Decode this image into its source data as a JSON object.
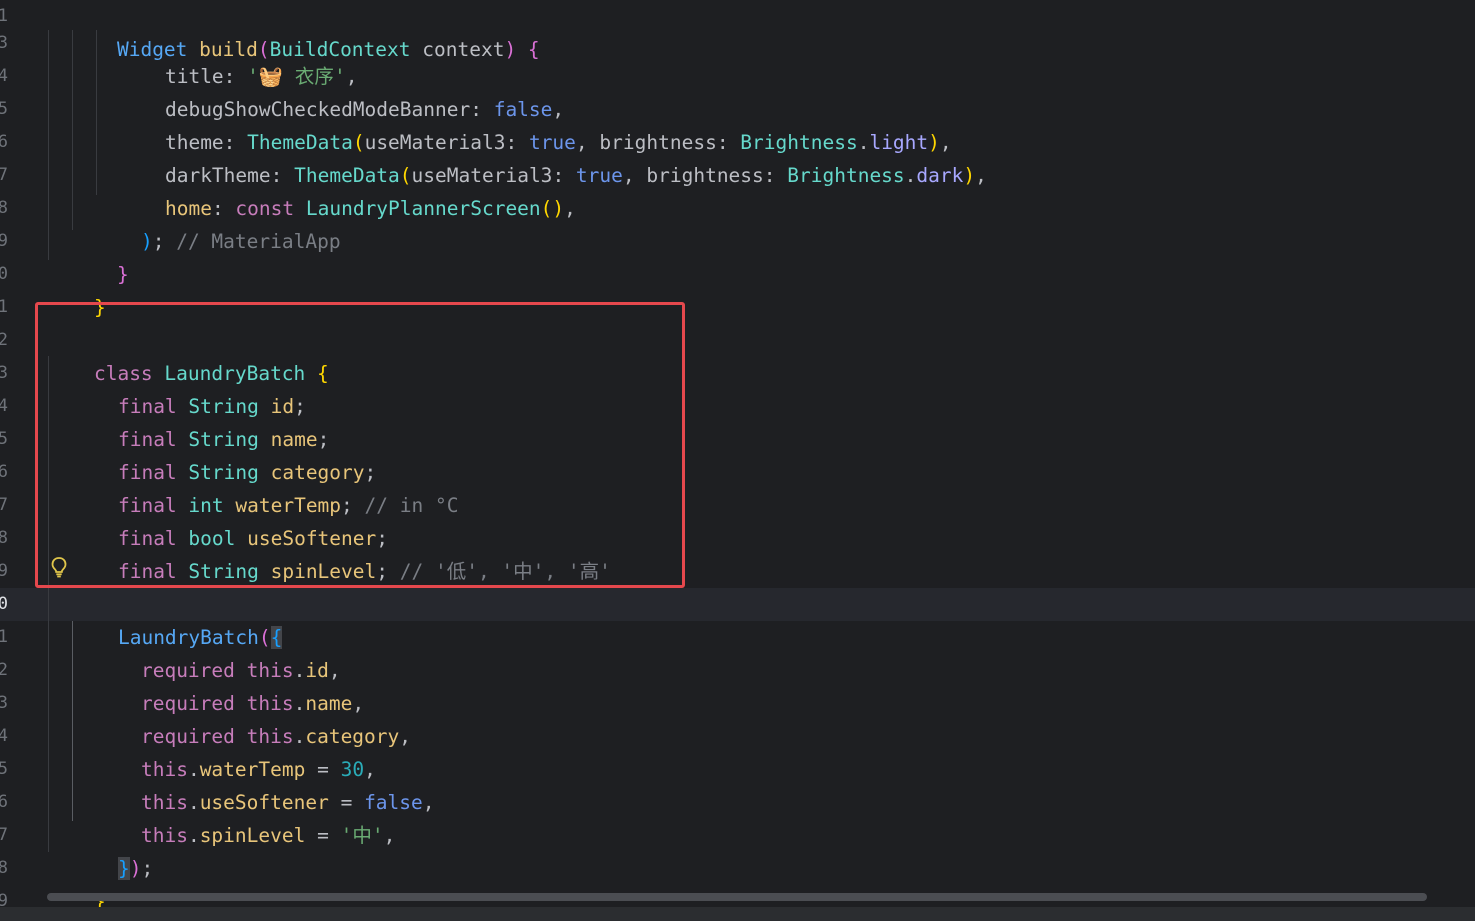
{
  "editor": {
    "gutter_line_numbers": [
      "1",
      "3",
      "4",
      "5",
      "6",
      "7",
      "8",
      "9",
      "0",
      "1",
      "2",
      "3",
      "4",
      "5",
      "6",
      "7",
      "8",
      "9",
      "0",
      "1",
      "2",
      "3",
      "4",
      "5",
      "6",
      "7",
      "8",
      "9"
    ],
    "lines": {
      "l01": {
        "a": "Widget",
        "b": " build",
        "c": "(",
        "d": "BuildContext",
        "e": " context",
        "f": ")",
        "g": " {"
      },
      "l02": {
        "a": "title",
        "b": ": ",
        "c": "'",
        "d": "🧺 衣序",
        "e": "'",
        "f": ","
      },
      "l03": {
        "a": "debugShowCheckedModeBanner",
        "b": ": ",
        "c": "false",
        "d": ","
      },
      "l04": {
        "a": "theme",
        "b": ": ",
        "c": "ThemeData",
        "d": "(",
        "e": "useMaterial3",
        "f": ": ",
        "g": "true",
        "h": ", ",
        "i": "brightness",
        "j": ": ",
        "k": "Brightness",
        "l": ".",
        "m": "light",
        "n": ")",
        "o": ","
      },
      "l05": {
        "a": "darkTheme",
        "b": ": ",
        "c": "ThemeData",
        "d": "(",
        "e": "useMaterial3",
        "f": ": ",
        "g": "true",
        "h": ", ",
        "i": "brightness",
        "j": ": ",
        "k": "Brightness",
        "l": ".",
        "m": "dark",
        "n": ")",
        "o": ","
      },
      "l06": {
        "a": "home",
        "b": ": ",
        "c": "const",
        "d": " LaundryPlannerScreen",
        "e": "()",
        "f": ","
      },
      "l07": {
        "a": ")",
        "b": "; ",
        "c": "// MaterialApp"
      },
      "l08": {
        "a": "}"
      },
      "l09": {
        "a": "}"
      },
      "l11": {
        "a": "class",
        "b": " LaundryBatch",
        "c": " {"
      },
      "l12": {
        "a": "final",
        "b": " String",
        "c": " id",
        "d": ";"
      },
      "l13": {
        "a": "final",
        "b": " String",
        "c": " name",
        "d": ";"
      },
      "l14": {
        "a": "final",
        "b": " String",
        "c": " category",
        "d": ";"
      },
      "l15": {
        "a": "final",
        "b": " int",
        "c": " waterTemp",
        "d": "; ",
        "e": "// in °C"
      },
      "l16": {
        "a": "final",
        "b": " bool",
        "c": " useSoftener",
        "d": ";"
      },
      "l17": {
        "a": "final",
        "b": " String",
        "c": " spinLevel",
        "d": "; ",
        "e": "// '低', '中', '高'"
      },
      "l19": {
        "a": "LaundryBatch",
        "b": "(",
        "c": "{"
      },
      "l20": {
        "a": "required",
        "b": " this",
        "c": ".",
        "d": "id",
        "e": ","
      },
      "l21": {
        "a": "required",
        "b": " this",
        "c": ".",
        "d": "name",
        "e": ","
      },
      "l22": {
        "a": "required",
        "b": " this",
        "c": ".",
        "d": "category",
        "e": ","
      },
      "l23": {
        "a": "this",
        "b": ".",
        "c": "waterTemp",
        "d": " = ",
        "e": "30",
        "f": ","
      },
      "l24": {
        "a": "this",
        "b": ".",
        "c": "useSoftener",
        "d": " = ",
        "e": "false",
        "f": ","
      },
      "l25": {
        "a": "this",
        "b": ".",
        "c": "spinLevel",
        "d": " = ",
        "e": "'中'",
        "f": ","
      },
      "l26": {
        "a": "}",
        "b": ")",
        "c": ";"
      },
      "l27": {
        "a": "}"
      }
    }
  },
  "colors": {
    "background": "#1e1f22",
    "highlight_box": "#e5484d",
    "bulb": "#e0c64b"
  },
  "icons": {
    "bulb": "lightbulb-icon"
  }
}
